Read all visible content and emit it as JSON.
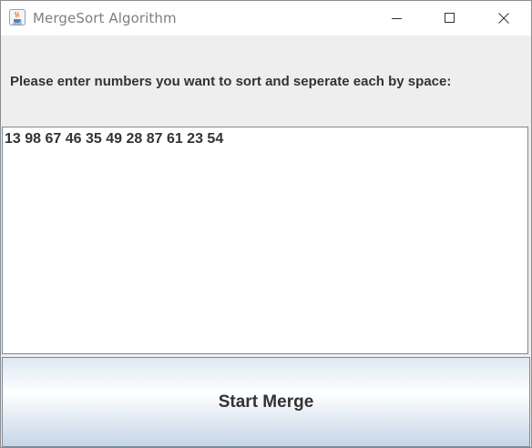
{
  "window": {
    "title": "MergeSort Algorithm",
    "icon": "java-cup-icon",
    "controls": {
      "minimize": "minimize-icon",
      "maximize": "maximize-icon",
      "close": "close-icon"
    }
  },
  "form": {
    "prompt": "Please enter numbers you want to sort and seperate each by space:",
    "input_value": "13 98 67 46 35 49 28 87 61 23 54",
    "submit_label": "Start Merge"
  }
}
